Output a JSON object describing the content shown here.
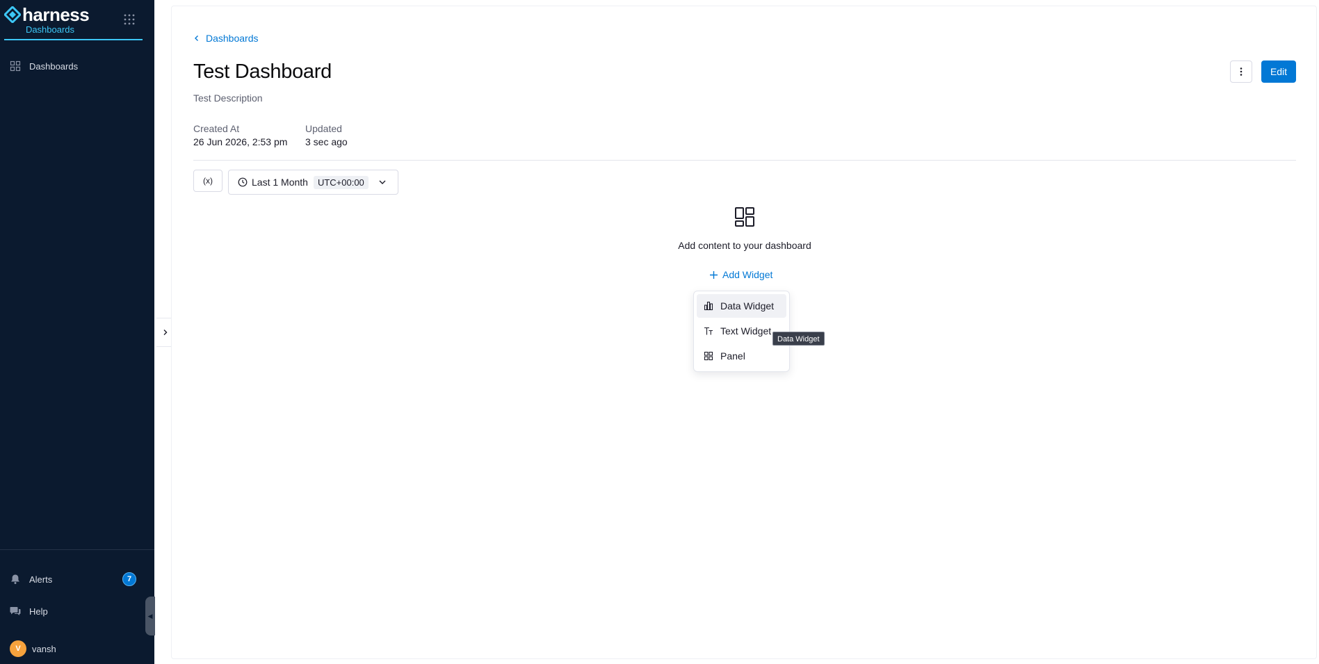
{
  "sidebar": {
    "brand": "harness",
    "module": "Dashboards",
    "nav": [
      {
        "label": "Dashboards",
        "icon": "grid-icon"
      }
    ],
    "alerts": {
      "label": "Alerts",
      "count": "7"
    },
    "help": {
      "label": "Help"
    },
    "user": {
      "initial": "V",
      "name": "vansh"
    }
  },
  "header": {
    "breadcrumb": "Dashboards",
    "title": "Test Dashboard",
    "description": "Test Description",
    "created_label": "Created At",
    "created_value": "26 Jun 2026, 2:53 pm",
    "updated_label": "Updated",
    "updated_value": "3 sec ago",
    "edit_label": "Edit"
  },
  "filters": {
    "variables_label": "(x)",
    "time_range": "Last 1 Month",
    "timezone": "UTC+00:00"
  },
  "empty_state": {
    "message": "Add content to your dashboard",
    "add_label": "Add Widget"
  },
  "menu": {
    "items": [
      {
        "label": "Data Widget",
        "icon": "bar-chart-icon"
      },
      {
        "label": "Text Widget",
        "icon": "text-icon"
      },
      {
        "label": "Panel",
        "icon": "panel-grid-icon"
      }
    ]
  },
  "tooltip": "Data Widget",
  "colors": {
    "sidebar_bg": "#0b1a2f",
    "accent": "#3dc7f6",
    "primary": "#0278d5"
  }
}
